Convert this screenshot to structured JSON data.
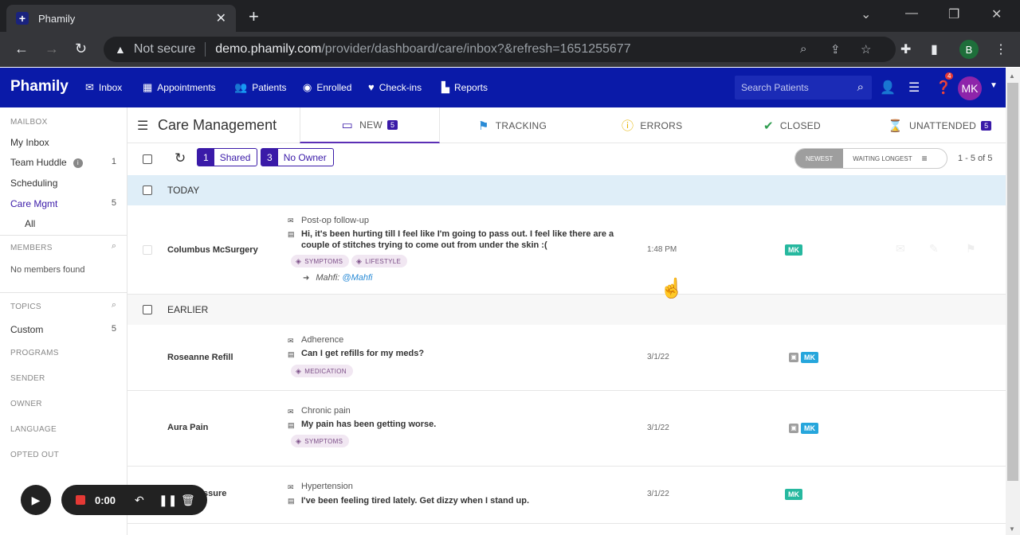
{
  "browser": {
    "tab_title": "Phamily",
    "tab_favicon": "+",
    "security_label": "Not secure",
    "url_host": "demo.phamily.com",
    "url_path": "/provider/dashboard/care/inbox?&refresh=1651255677",
    "profile_initial": "B"
  },
  "app": {
    "brand": "Phamily",
    "nav": [
      {
        "label": "Inbox",
        "icon": "mail-icon"
      },
      {
        "label": "Appointments",
        "icon": "calendar-icon"
      },
      {
        "label": "Patients",
        "icon": "people-icon"
      },
      {
        "label": "Enrolled",
        "icon": "globe-icon"
      },
      {
        "label": "Check-ins",
        "icon": "heart-pulse-icon"
      },
      {
        "label": "Reports",
        "icon": "bar-chart-icon"
      }
    ],
    "search_placeholder": "Search Patients",
    "notification_count": "4",
    "avatar_initials": "MK",
    "colors": {
      "header": "#0a1aa8",
      "accent": "#3a1aa8",
      "owner_badge_green": "#26b89f",
      "owner_badge_blue": "#26a6dc"
    }
  },
  "sidebar": {
    "mailbox_heading": "MAILBOX",
    "items": [
      {
        "label": "My Inbox",
        "count": ""
      },
      {
        "label": "Team Huddle",
        "count": "1"
      },
      {
        "label": "Scheduling",
        "count": ""
      },
      {
        "label": "Care Mgmt",
        "count": "5"
      },
      {
        "label": "All",
        "count": ""
      }
    ],
    "members_heading": "MEMBERS",
    "members_empty": "No members found",
    "topics_heading": "TOPICS",
    "topics": [
      {
        "label": "Custom",
        "count": "5"
      }
    ],
    "filters": [
      "PROGRAMS",
      "SENDER",
      "OWNER",
      "LANGUAGE",
      "OPTED OUT"
    ]
  },
  "main": {
    "title": "Care Management",
    "tabs": [
      {
        "label": "NEW",
        "badge": "5",
        "icon": "inbox-icon"
      },
      {
        "label": "TRACKING",
        "badge": "",
        "icon": "bookmark-icon"
      },
      {
        "label": "ERRORS",
        "badge": "",
        "icon": "alert-icon"
      },
      {
        "label": "CLOSED",
        "badge": "",
        "icon": "check-circle-icon"
      },
      {
        "label": "UNATTENDED",
        "badge": "5",
        "icon": "hourglass-icon"
      }
    ],
    "chips": [
      {
        "count": "1",
        "label": "Shared"
      },
      {
        "count": "3",
        "label": "No Owner"
      }
    ],
    "sort": {
      "newest": "NEWEST",
      "waiting": "WAITING LONGEST"
    },
    "page_count": "1 - 5 of 5",
    "groups": {
      "today": "TODAY",
      "earlier": "EARLIER"
    },
    "messages": [
      {
        "patient": "Columbus McSurgery",
        "topic": "Post-op follow-up",
        "text": "Hi, it's been hurting till I feel like I'm going to pass out. I feel like there are a couple of stitches trying to come out from under the skin :(",
        "tags": [
          "SYMPTOMS",
          "LIFESTYLE"
        ],
        "time": "1:48 PM",
        "owner": "MK",
        "reply_author": "Mahfi:",
        "reply_mention": "@Mahfi"
      },
      {
        "patient": "Roseanne Refill",
        "topic": "Adherence",
        "text": "Can I get refills for my meds?",
        "tags": [
          "MEDICATION"
        ],
        "time": "3/1/22",
        "owner": "MK"
      },
      {
        "patient": "Aura Pain",
        "topic": "Chronic pain",
        "text": "My pain has been getting worse.",
        "tags": [
          "SYMPTOMS"
        ],
        "time": "3/1/22",
        "owner": "MK"
      },
      {
        "patient": "ssure",
        "topic": "Hypertension",
        "text": "I've been feeling tired lately. Get dizzy when I stand up.",
        "tags": [],
        "time": "3/1/22",
        "owner": "MK"
      }
    ]
  },
  "recorder": {
    "time": "0:00"
  }
}
